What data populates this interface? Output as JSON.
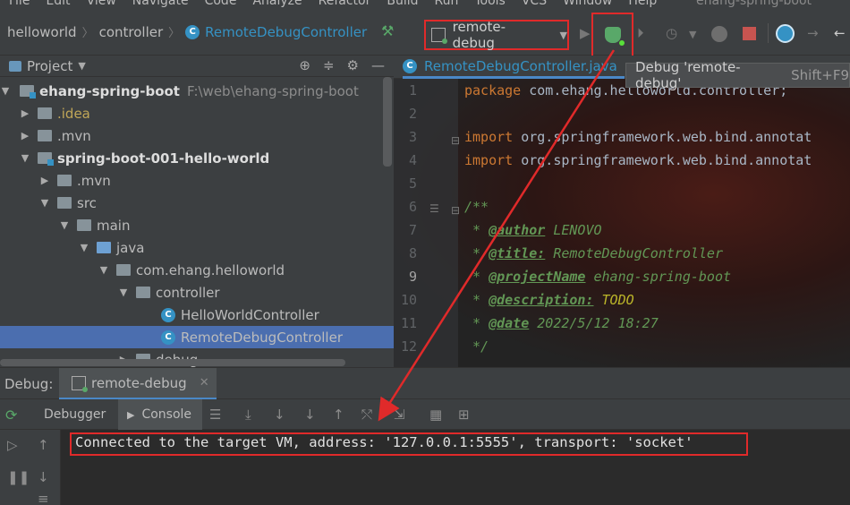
{
  "window_title": "ehang-spring-boot",
  "menu": [
    "File",
    "Edit",
    "View",
    "Navigate",
    "Code",
    "Analyze",
    "Refactor",
    "Build",
    "Run",
    "Tools",
    "VCS",
    "Window",
    "Help"
  ],
  "breadcrumb": [
    "helloworld",
    "controller",
    "RemoteDebugController"
  ],
  "run_config": {
    "label": "remote-debug"
  },
  "debug_tooltip": {
    "text": "Debug 'remote-debug'",
    "shortcut": "Shift+F9"
  },
  "project_panel": {
    "title": "Project",
    "tree": [
      {
        "label": "ehang-spring-boot",
        "sub": "F:\\web\\ehang-spring-boot"
      },
      {
        "label": ".idea"
      },
      {
        "label": ".mvn"
      },
      {
        "label": "spring-boot-001-hello-world"
      },
      {
        "label": ".mvn"
      },
      {
        "label": "src"
      },
      {
        "label": "main"
      },
      {
        "label": "java"
      },
      {
        "label": "com.ehang.helloworld"
      },
      {
        "label": "controller"
      },
      {
        "label": "HelloWorldController"
      },
      {
        "label": "RemoteDebugController"
      },
      {
        "label": "debug"
      }
    ]
  },
  "editor": {
    "tab": "RemoteDebugController.java",
    "line_numbers": [
      "1",
      "2",
      "3",
      "4",
      "5",
      "6",
      "7",
      "8",
      "9",
      "10",
      "11",
      "12"
    ],
    "code": {
      "pkg_kw": "package",
      "pkg_name": " com.ehang.helloworld.controller;",
      "import_kw": "import",
      "import1": " org.springframework.web.bind.annotat",
      "import2": " org.springframework.web.bind.annotat",
      "doc_open": "/**",
      "author_tag": "@author",
      "author_val": " LENOVO",
      "title_tag": "@title:",
      "title_val": " RemoteDebugController",
      "project_tag": "@projectName",
      "project_val": " ehang-spring-boot",
      "desc_tag": "@description:",
      "desc_val": " TODO",
      "date_tag": "@date",
      "date_val": " 2022/5/12 18:27",
      "doc_close": " */",
      "star": " * "
    }
  },
  "debug_window": {
    "label": "Debug:",
    "tab": "remote-debug",
    "subtabs": [
      "Debugger",
      "Console"
    ],
    "console_output": "Connected to the target VM, address: '127.0.0.1:5555', transport: 'socket'"
  },
  "colors": {
    "highlight_box": "#e02a2a",
    "selection": "#4b6eaf",
    "accent_blue": "#3592c4"
  }
}
